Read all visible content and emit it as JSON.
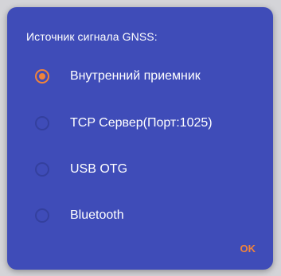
{
  "dialog": {
    "title": "Источник сигнала GNSS:",
    "ok_label": "OK"
  },
  "options": [
    {
      "label": "Внутренний приемник",
      "selected": true
    },
    {
      "label": "TCP Сервер(Порт:1025)",
      "selected": false
    },
    {
      "label": "USB OTG",
      "selected": false
    },
    {
      "label": "Bluetooth",
      "selected": false
    }
  ],
  "colors": {
    "dialog_bg": "#3f4cb8",
    "accent": "#f0833b",
    "text": "#ffffff"
  }
}
